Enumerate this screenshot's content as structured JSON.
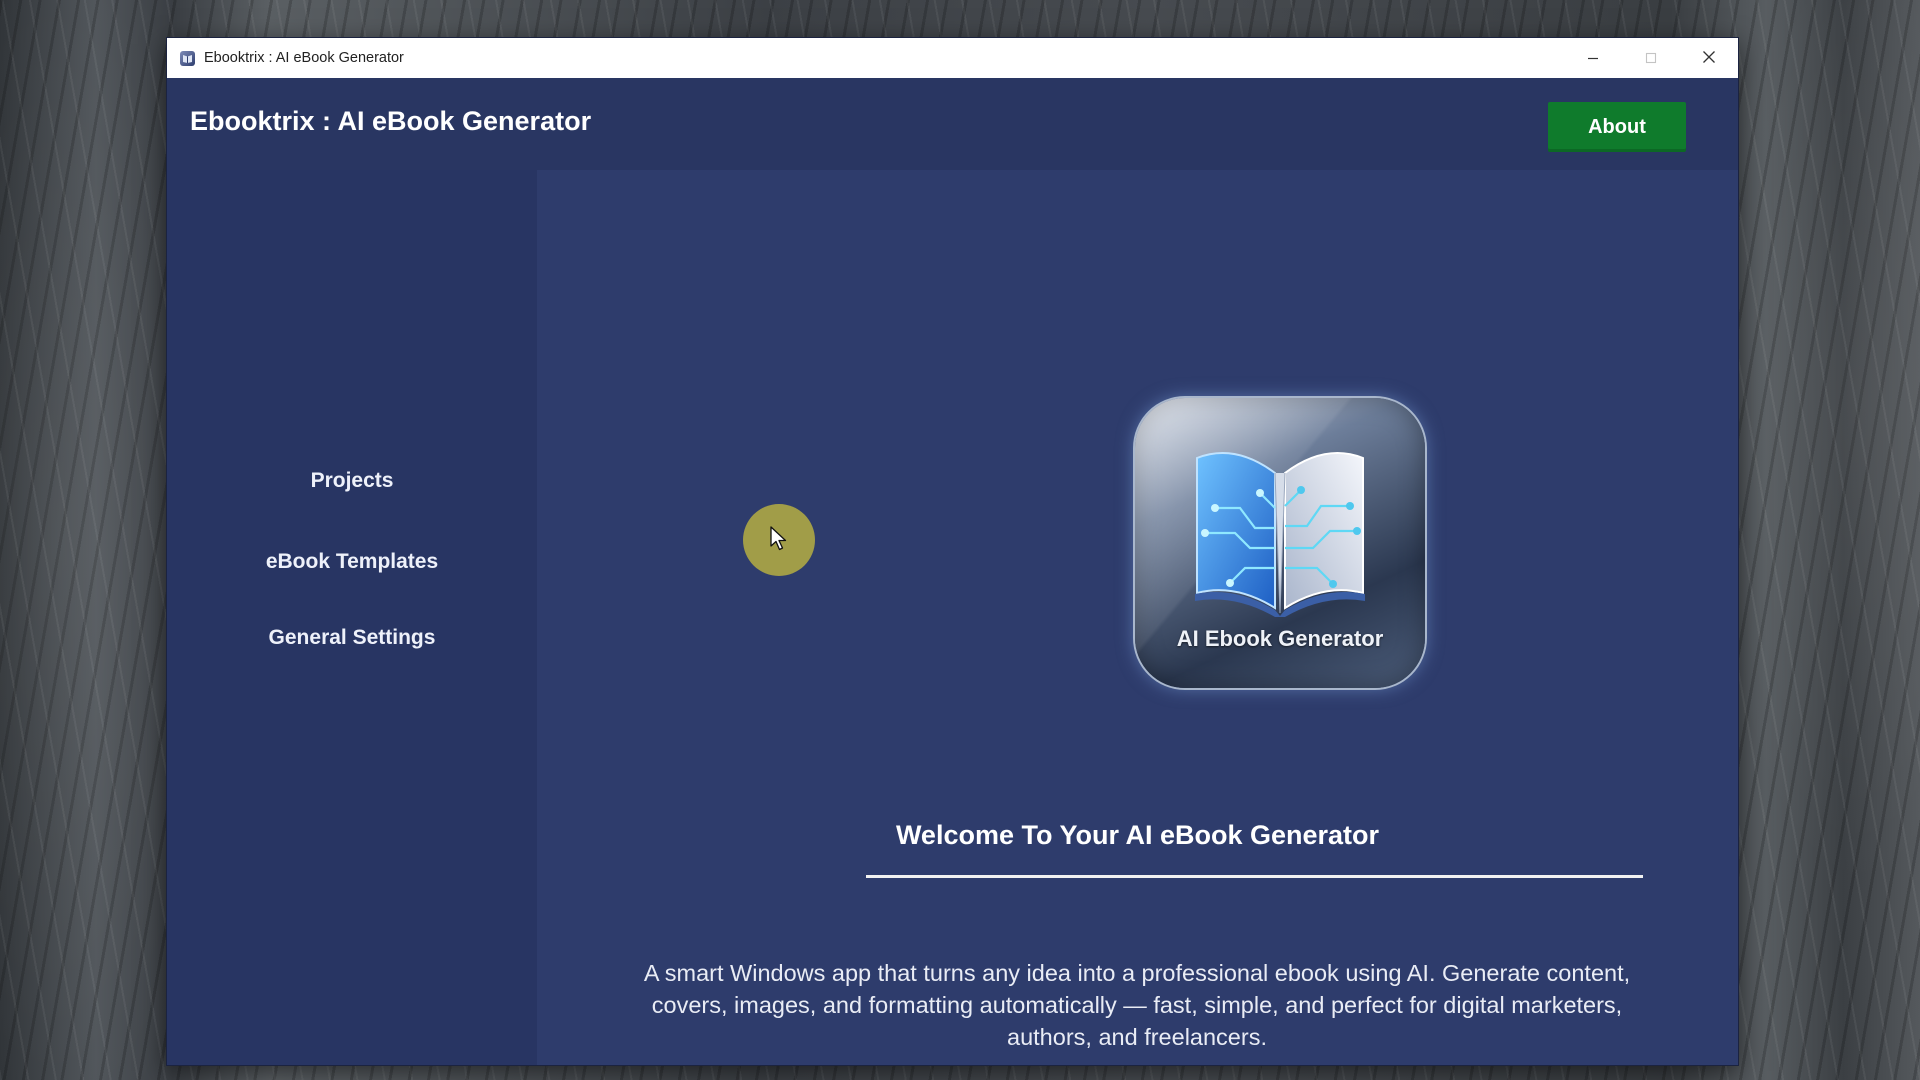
{
  "window": {
    "title": "Ebooktrix : AI eBook Generator",
    "icon": "app-icon"
  },
  "window_controls": {
    "minimize": "minimize-icon",
    "maximize": "maximize-icon",
    "close": "close-icon"
  },
  "header": {
    "title": "Ebooktrix : AI eBook Generator",
    "about_label": "About"
  },
  "sidebar": {
    "items": [
      {
        "label": "Projects"
      },
      {
        "label": "eBook Templates"
      },
      {
        "label": "General Settings"
      }
    ]
  },
  "main": {
    "logo_caption": "AI Ebook Generator",
    "welcome_title": "Welcome To Your AI eBook Generator",
    "description": "A smart Windows app that turns any idea into a professional ebook using AI. Generate content, covers, images, and formatting automatically — fast, simple, and perfect for digital marketers, authors, and freelancers."
  },
  "colors": {
    "header_bg": "#293662",
    "sidebar_bg": "#283563",
    "main_bg": "#2e3c6c",
    "about_button": "#0f7b2c",
    "cursor_highlight": "#c8be3c"
  }
}
